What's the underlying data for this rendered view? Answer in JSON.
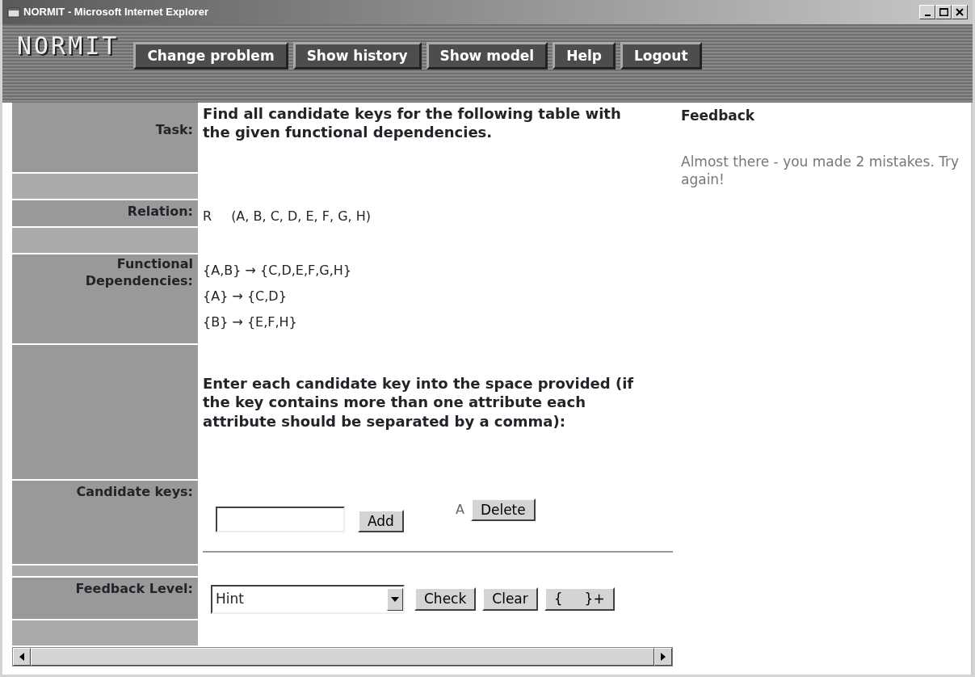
{
  "window": {
    "title": "NORMIT - Microsoft Internet Explorer"
  },
  "header": {
    "logo": "NORMIT",
    "buttons": [
      "Change problem",
      "Show history",
      "Show model",
      "Help",
      "Logout"
    ]
  },
  "rows": [
    {
      "kind": "task",
      "label": "Task:",
      "text": "Find all candidate keys for the following table with the given functional dependencies."
    },
    {
      "kind": "spacer"
    },
    {
      "kind": "relation",
      "label": "Relation:",
      "name": "R",
      "attributes": "(A, B, C, D, E, F, G, H)"
    },
    {
      "kind": "spacer"
    },
    {
      "kind": "dependencies",
      "label": "Functional Dependencies:",
      "lines": [
        "{A,B} → {C,D,E,F,G,H}",
        "{A} → {C,D}",
        "{B} → {E,F,H}"
      ]
    },
    {
      "kind": "instructions",
      "text": "Enter each candidate key into the space provided (if the key contains more than one attribute each attribute should be separated by a comma):"
    },
    {
      "kind": "keys",
      "label": "Candidate keys:",
      "add_button": "Add",
      "keys": [
        {
          "value": "A",
          "button": "Delete"
        }
      ],
      "divider_below": true
    },
    {
      "kind": "spacer"
    },
    {
      "kind": "feedback_level",
      "label": "Feedback Level:",
      "select": "Hint",
      "buttons": [
        "Check",
        "Clear",
        "{     }+"
      ]
    },
    {
      "kind": "spacer"
    }
  ],
  "feedback": {
    "title": "Feedback",
    "message": "Almost there - you made 2 mistakes. Try again!"
  }
}
